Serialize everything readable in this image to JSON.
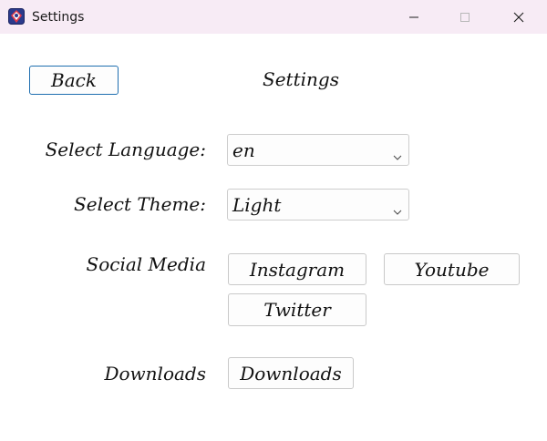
{
  "window": {
    "title": "Settings",
    "icon": "app-icon"
  },
  "controls": {
    "minimize_icon": "minimize-icon",
    "maximize_icon": "maximize-icon",
    "close_icon": "close-icon"
  },
  "header": {
    "back_label": "Back",
    "title": "Settings"
  },
  "language": {
    "label": "Select Language:",
    "value": "en"
  },
  "theme": {
    "label": "Select Theme:",
    "value": "Light"
  },
  "social": {
    "label": "Social Media",
    "buttons": [
      "Instagram",
      "Youtube",
      "Twitter"
    ]
  },
  "downloads": {
    "label": "Downloads",
    "button_label": "Downloads"
  },
  "colors": {
    "titlebar_bg": "#f7ebf5",
    "focus_border": "#1f6fb0"
  }
}
